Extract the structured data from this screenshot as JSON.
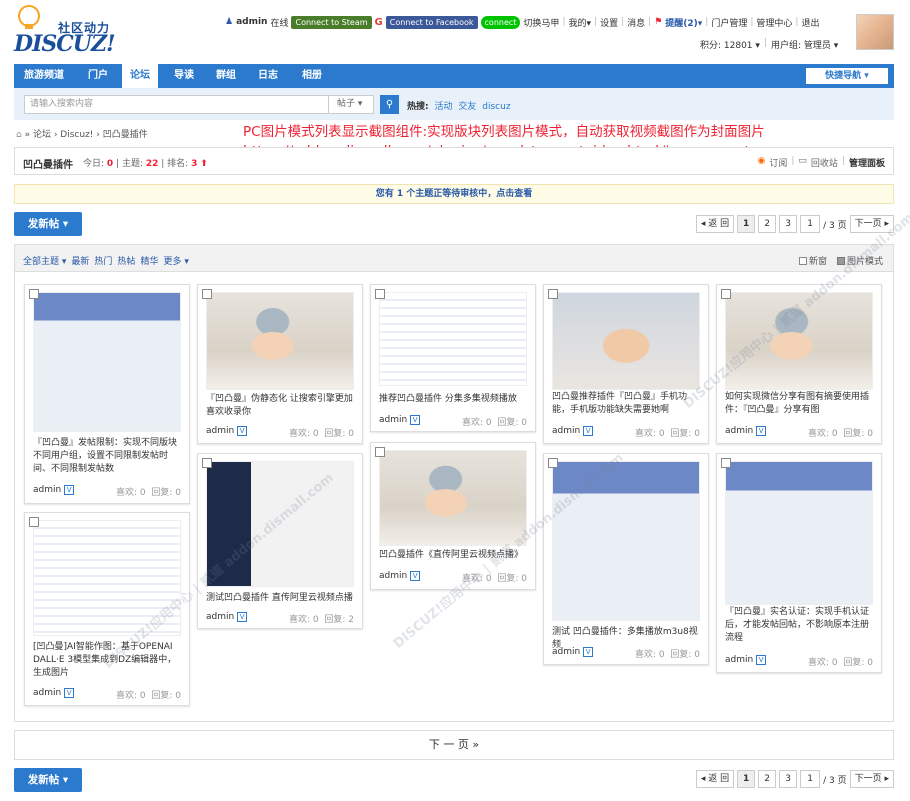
{
  "logo": {
    "cn": "社区动力",
    "en": "DISCUZ!"
  },
  "topbar": {
    "username": "admin",
    "online": "在线",
    "steam": "Connect to Steam",
    "facebook": "Connect to Facebook",
    "line": "connect",
    "links": [
      "切换马甲",
      "我的▾",
      "设置",
      "消息",
      "提醒(2)▾",
      "门户管理",
      "管理中心",
      "退出"
    ],
    "points": "积分: 12801 ▾",
    "usergroup": "用户组: 管理员 ▾"
  },
  "nav": {
    "items": [
      "旅游频道",
      "门户",
      "论坛",
      "导读",
      "群组",
      "日志",
      "相册"
    ],
    "active": 2,
    "quick": "快捷导航 ▾"
  },
  "search": {
    "placeholder": "请输入搜索内容",
    "type": "帖子 ▾",
    "hot_label": "热搜:",
    "hot_words": [
      "活动",
      "交友",
      "discuz"
    ]
  },
  "breadcrumb": {
    "items": [
      "论坛",
      "Discuz!",
      "凹凸曼插件"
    ]
  },
  "promo": {
    "line1": "PC图片模式列表显示截图组件:实现版块列表图片模式，自动获取视频截图作为封面图片",
    "line2": "https://addon.dismall.com/plugins/apoyl_tencentvideo.html#component"
  },
  "forum": {
    "name": "凹凸曼插件",
    "today_label": "今日:",
    "today": "0",
    "topics_label": "主题:",
    "topics": "22",
    "rank_label": "排名:",
    "rank": "3",
    "subscribe": "订阅",
    "recycle": "回收站",
    "manage": "管理面板"
  },
  "notice": "您有 1 个主题正等待审核中，点击查看",
  "post_button": "发新帖 ▾",
  "pager": {
    "back": "◂ 返 回",
    "pages": [
      "1",
      "2",
      "3"
    ],
    "current": "1",
    "total": "/ 3 页",
    "next": "下一页 ▸"
  },
  "filter": {
    "left": [
      "全部主题 ▾",
      "最新",
      "热门",
      "热帖",
      "精华",
      "更多 ▾"
    ],
    "new_window": "新窗",
    "pic_mode": "图片模式"
  },
  "cards": [
    {
      "title": "『凹凸曼』发帖限制：实现不同版块不同用户组，设置不同限制发帖时间、不同限制发帖数",
      "author": "admin",
      "likes": "喜欢: 0",
      "replies": "回复: 0",
      "thumb": "phone"
    },
    {
      "title": "『凹凸曼』伪静态化 让搜索引擎更加喜欢收录你",
      "author": "admin",
      "likes": "喜欢: 0",
      "replies": "回复: 0",
      "thumb": "baby"
    },
    {
      "title": "推荐凹凸曼插件 分集多集视频播放",
      "author": "admin",
      "likes": "喜欢: 0",
      "replies": "回复: 0",
      "thumb": "shot"
    },
    {
      "title": "凹凸曼推荐插件『凹凸曼』手机功能，手机版功能缺失需要她啊",
      "author": "admin",
      "likes": "喜欢: 0",
      "replies": "回复: 0",
      "thumb": "baby2"
    },
    {
      "title": "如何实现微信分享有图有摘要使用插件：『凹凸曼』分享有图",
      "author": "admin",
      "likes": "喜欢: 0",
      "replies": "回复: 0",
      "thumb": "baby"
    },
    {
      "title": "[凹凸曼]AI智能作图：基于OPENAI DALL·E 3模型集成到DZ编辑器中，生成图片",
      "author": "admin",
      "likes": "喜欢: 0",
      "replies": "回复: 0",
      "thumb": "shot"
    },
    {
      "title": "测试凹凸曼插件 直传阿里云视频点播",
      "author": "admin",
      "likes": "喜欢: 0",
      "replies": "回复: 2",
      "thumb": "dark"
    },
    {
      "title": "凹凸曼插件《直传阿里云视频点播》",
      "author": "admin",
      "likes": "喜欢: 0",
      "replies": "回复: 0",
      "thumb": "baby"
    },
    {
      "title": "测试 凹凸曼插件：多集播放m3u8视频",
      "author": "admin",
      "likes": "喜欢: 0",
      "replies": "回复: 0",
      "thumb": "phone"
    },
    {
      "title": "『凹凸曼』实名认证：实现手机认证后，才能发帖回帖，不影响原本注册流程",
      "author": "admin",
      "likes": "喜欢: 0",
      "replies": "回复: 0",
      "thumb": "phone"
    }
  ],
  "next_page": "下 一 页  »",
  "watermark": "DISCUZ!应用中心 | 贰道  addon.dismall.com"
}
